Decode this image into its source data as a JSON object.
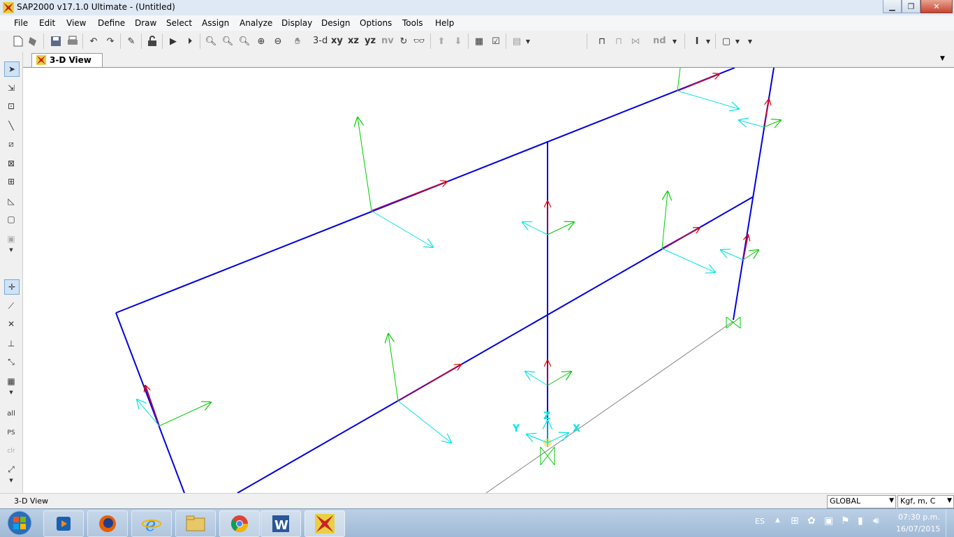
{
  "window": {
    "title": "SAP2000 v17.1.0 Ultimate  - (Untitled)",
    "controls": [
      "minimize",
      "maximize",
      "close"
    ]
  },
  "menu": [
    "File",
    "Edit",
    "View",
    "Define",
    "Draw",
    "Select",
    "Assign",
    "Analyze",
    "Display",
    "Design",
    "Options",
    "Tools",
    "Help"
  ],
  "toolbar": {
    "view_3d": "3-d",
    "view_xy": "xy",
    "view_xz": "xz",
    "view_yz": "yz",
    "view_nv": "nv",
    "label_nd": "nd"
  },
  "lefttools": {
    "all": "all",
    "ps": "PS",
    "clr": "clr"
  },
  "tabs": {
    "active_tab": "3-D View"
  },
  "viewport": {
    "axis_z": "Z",
    "axis_y": "Y",
    "axis_x": "X",
    "colors": {
      "frame": "#0000e0",
      "local_axis_1": "#e00000",
      "local_axis_2": "#00cc00",
      "local_axis_3": "#00e5e5",
      "support": "#00cc00",
      "ground_line": "#808080"
    }
  },
  "statusbar": {
    "view_name": "3-D View",
    "coord_system": "GLOBAL",
    "units": "Kgf, m, C"
  },
  "taskbar": {
    "language": "ES",
    "time": "07:30 p.m.",
    "date": "16/07/2015",
    "apps": [
      "windows-media-player-icon",
      "firefox-icon",
      "internet-explorer-icon",
      "file-explorer-icon",
      "chrome-icon",
      "word-icon",
      "sap2000-icon"
    ]
  }
}
